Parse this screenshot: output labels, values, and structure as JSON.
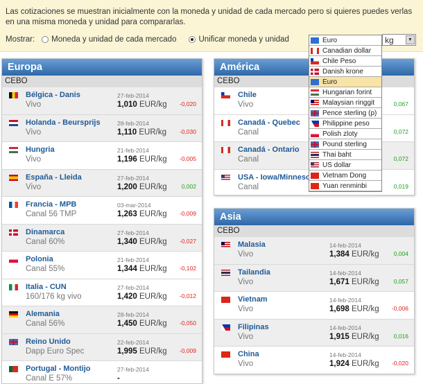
{
  "notice": {
    "text": "Las cotizaciones se muestran inicialmente con la moneda y unidad de cada mercado pero si quieres puedes verlas en una misma moneda y unidad para compararlas.",
    "show_label": "Mostrar:",
    "option1": "Moneda y unidad de cada mercado",
    "option2": "Unificar moneda y unidad",
    "selected_option": "option2"
  },
  "currency": {
    "selected": "Euro",
    "unit": "kg",
    "options": [
      {
        "label": "Canadian dollar",
        "flag": "canada"
      },
      {
        "label": "Chile Peso",
        "flag": "chile"
      },
      {
        "label": "Danish krone",
        "flag": "denmark"
      },
      {
        "label": "Euro",
        "flag": "eu",
        "highlighted": true
      },
      {
        "label": "Hungarian forint",
        "flag": "hungary"
      },
      {
        "label": "Malaysian ringgit",
        "flag": "malaysia"
      },
      {
        "label": "Pence sterling (p)",
        "flag": "uk"
      },
      {
        "label": "Philippine peso",
        "flag": "philippines"
      },
      {
        "label": "Polish zloty",
        "flag": "poland"
      },
      {
        "label": "Pound sterling",
        "flag": "uk"
      },
      {
        "label": "Thai baht",
        "flag": "thailand"
      },
      {
        "label": "US dollar",
        "flag": "usa"
      },
      {
        "label": "Vietnam Dong",
        "flag": "vietnam"
      },
      {
        "label": "Yuan renminbi",
        "flag": "china"
      }
    ]
  },
  "europa": {
    "title": "Europa",
    "group": "CEBO",
    "rows": [
      {
        "name": "Bélgica - Danis",
        "sub": "Vivo",
        "date": "27-feb-2014",
        "price": "1,010",
        "unit": "EUR/kg",
        "change": "-0,020",
        "flag": "belgium"
      },
      {
        "name": "Holanda - Beursprijs",
        "sub": "Vivo",
        "date": "28-feb-2014",
        "price": "1,110",
        "unit": "EUR/kg",
        "change": "-0,030",
        "flag": "netherlands"
      },
      {
        "name": "Hungria",
        "sub": "Vivo",
        "date": "21-feb-2014",
        "price": "1,196",
        "unit": "EUR/kg",
        "change": "-0,005",
        "flag": "hungary"
      },
      {
        "name": "España - Lleida",
        "sub": "Vivo",
        "date": "27-feb-2014",
        "price": "1,200",
        "unit": "EUR/kg",
        "change": "0,002",
        "flag": "spain"
      },
      {
        "name": "Francia - MPB",
        "sub": "Canal 56 TMP",
        "date": "03-mar-2014",
        "price": "1,263",
        "unit": "EUR/kg",
        "change": "-0,009",
        "flag": "france"
      },
      {
        "name": "Dinamarca",
        "sub": "Canal 60%",
        "date": "27-feb-2014",
        "price": "1,340",
        "unit": "EUR/kg",
        "change": "-0,027",
        "flag": "denmark"
      },
      {
        "name": "Polonia",
        "sub": "Canal 55%",
        "date": "21-feb-2014",
        "price": "1,344",
        "unit": "EUR/kg",
        "change": "-0,102",
        "flag": "poland"
      },
      {
        "name": "Italia - CUN",
        "sub": "160/176 kg vivo",
        "date": "27-feb-2014",
        "price": "1,420",
        "unit": "EUR/kg",
        "change": "-0,012",
        "flag": "italy"
      },
      {
        "name": "Alemania",
        "sub": "Canal 56%",
        "date": "28-feb-2014",
        "price": "1,450",
        "unit": "EUR/kg",
        "change": "-0,050",
        "flag": "germany"
      },
      {
        "name": "Reino Unido",
        "sub": "Dapp Euro Spec",
        "date": "22-feb-2014",
        "price": "1,995",
        "unit": "EUR/kg",
        "change": "-0,009",
        "flag": "uk"
      },
      {
        "name": "Portugal - Montijo",
        "sub": "Canal E 57%",
        "date": "27-feb-2014",
        "price": "-",
        "unit": "",
        "change": "",
        "flag": "portugal"
      }
    ]
  },
  "america": {
    "title": "América",
    "group": "CEBO",
    "rows": [
      {
        "name": "Chile",
        "sub": "Vivo",
        "change": "0,067",
        "flag": "chile"
      },
      {
        "name": "Canadá - Quebec",
        "sub": "Canal",
        "change": "0,072",
        "flag": "canada"
      },
      {
        "name": "Canadá - Ontario",
        "sub": "Canal",
        "change": "0,072",
        "flag": "canada"
      },
      {
        "name": "USA - Iowa/Minnesota",
        "sub": "Canal",
        "change": "0,019",
        "flag": "usa"
      }
    ]
  },
  "asia": {
    "title": "Asia",
    "group": "CEBO",
    "rows": [
      {
        "name": "Malasia",
        "sub": "Vivo",
        "date": "14-feb-2014",
        "price": "1,384",
        "unit": "EUR/kg",
        "change": "0,004",
        "flag": "malaysia"
      },
      {
        "name": "Tailandia",
        "sub": "Vivo",
        "date": "14-feb-2014",
        "price": "1,671",
        "unit": "EUR/kg",
        "change": "0,057",
        "flag": "thailand"
      },
      {
        "name": "Vietnam",
        "sub": "Vivo",
        "date": "14-feb-2014",
        "price": "1,698",
        "unit": "EUR/kg",
        "change": "-0,006",
        "flag": "vietnam"
      },
      {
        "name": "Filipinas",
        "sub": "Vivo",
        "date": "14-feb-2014",
        "price": "1,915",
        "unit": "EUR/kg",
        "change": "0,016",
        "flag": "philippines"
      },
      {
        "name": "China",
        "sub": "Vivo",
        "date": "14-feb-2014",
        "price": "1,924",
        "unit": "EUR/kg",
        "change": "-0,020",
        "flag": "china"
      }
    ]
  }
}
